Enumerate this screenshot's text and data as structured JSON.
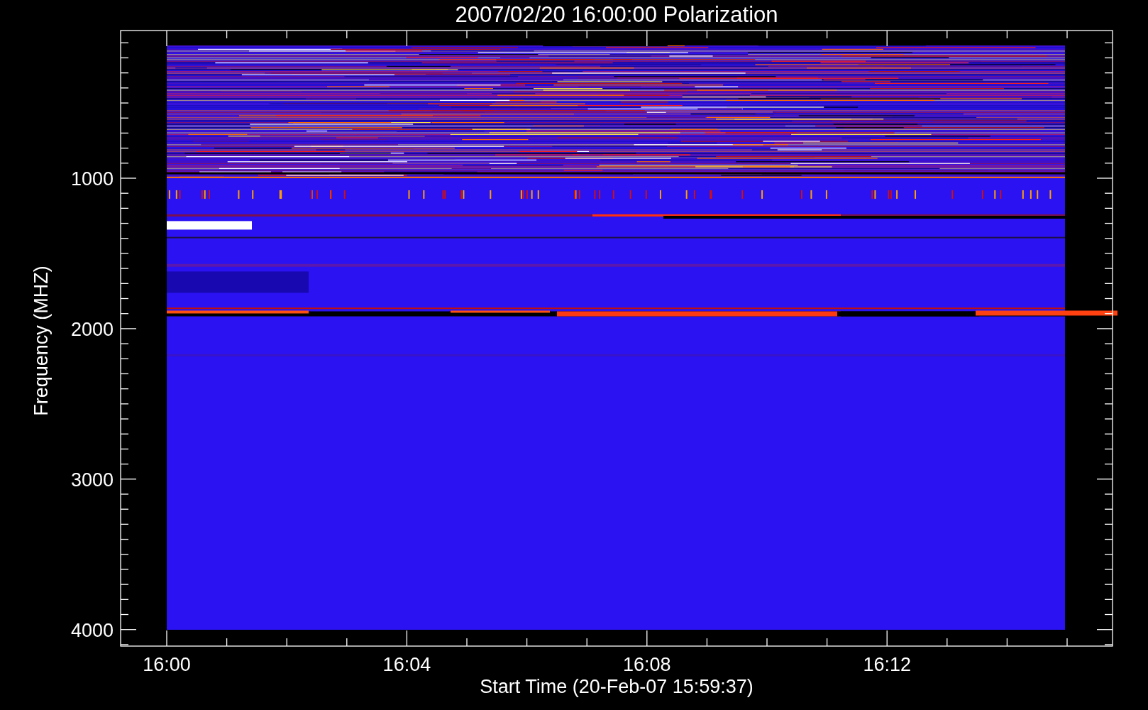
{
  "plot": {
    "title": "2007/02/20 16:00:00 Polarization",
    "xlabel": "Start Time (20-Feb-07 15:59:37)",
    "ylabel": "Frequency (MHZ)",
    "xticks": [
      "16:00",
      "16:04",
      "16:08",
      "16:12"
    ],
    "yticks": [
      "1000",
      "2000",
      "3000",
      "4000"
    ]
  }
}
